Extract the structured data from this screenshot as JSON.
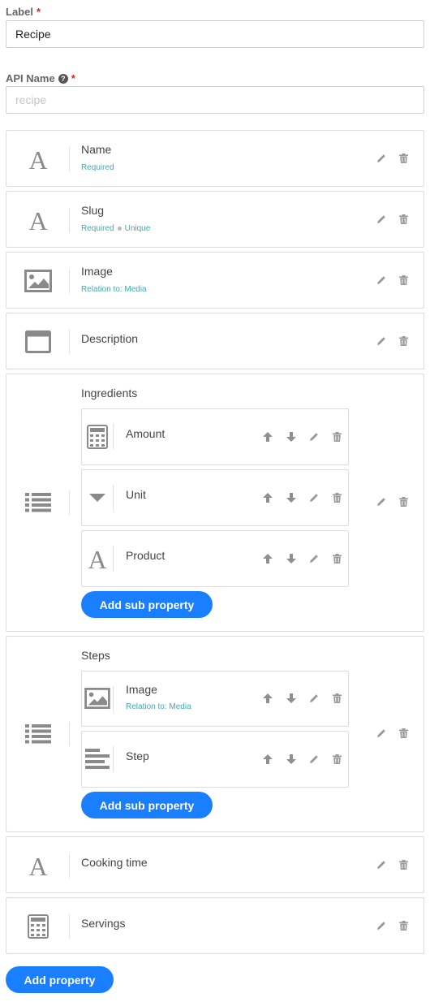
{
  "form": {
    "label_field": {
      "label": "Label",
      "required_mark": "*",
      "value": "Recipe"
    },
    "api_name_field": {
      "label": "API Name",
      "help_icon": "question-circle-icon",
      "required_mark": "*",
      "placeholder": "recipe"
    }
  },
  "properties": [
    {
      "name": "Name",
      "icon": "text-type-icon",
      "meta": [
        "Required"
      ]
    },
    {
      "name": "Slug",
      "icon": "text-type-icon",
      "meta": [
        "Required",
        "Unique"
      ]
    },
    {
      "name": "Image",
      "icon": "image-type-icon",
      "meta": [
        "Relation to: Media"
      ]
    },
    {
      "name": "Description",
      "icon": "richtext-type-icon",
      "meta": []
    },
    {
      "name": "Ingredients",
      "icon": "list-type-icon",
      "sub_properties": [
        {
          "name": "Amount",
          "icon": "number-type-icon"
        },
        {
          "name": "Unit",
          "icon": "select-type-icon"
        },
        {
          "name": "Product",
          "icon": "text-type-icon"
        }
      ],
      "add_sub_label": "Add sub property"
    },
    {
      "name": "Steps",
      "icon": "list-type-icon",
      "sub_properties": [
        {
          "name": "Image",
          "icon": "image-type-icon",
          "meta": "Relation to: Media"
        },
        {
          "name": "Step",
          "icon": "paragraph-type-icon"
        }
      ],
      "add_sub_label": "Add sub property"
    },
    {
      "name": "Cooking time",
      "icon": "text-type-icon",
      "meta": []
    },
    {
      "name": "Servings",
      "icon": "number-type-icon",
      "meta": []
    }
  ],
  "add_property_label": "Add property",
  "colors": {
    "accent": "#1a7fff",
    "meta_text": "#3fa9b5",
    "required": "#dd2222",
    "icon_gray": "#8a8a8a"
  }
}
